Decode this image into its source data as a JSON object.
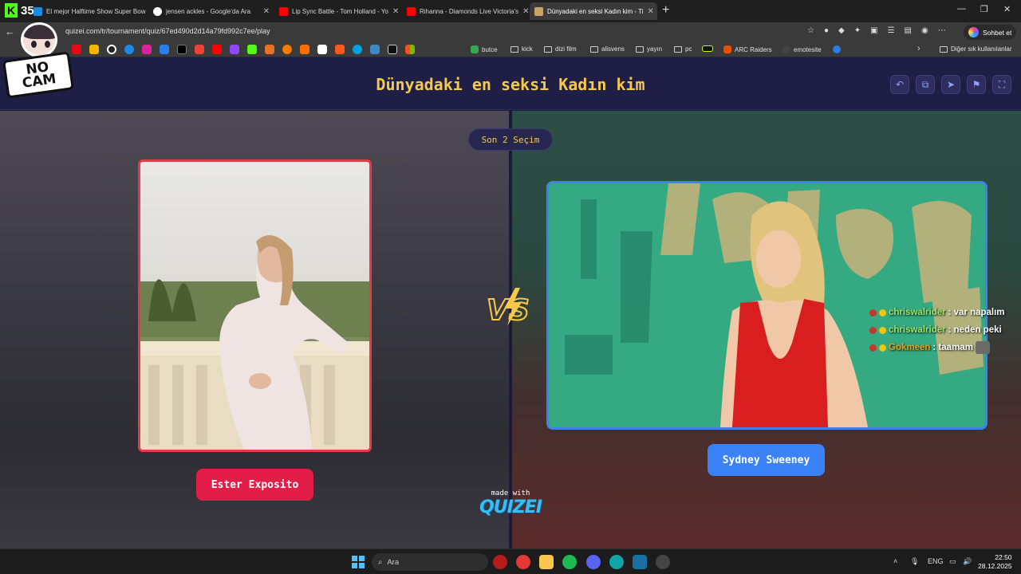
{
  "browser": {
    "tab_badge_count": "35",
    "tabs": [
      {
        "title": "El mejor Halftime Show Super Bow",
        "color": "#1e88e5"
      },
      {
        "title": "jensen ackles - Google'da Ara",
        "color": "#ffffff"
      },
      {
        "title": "Lip Sync Battle - Tom Holland - Yo",
        "color": "#ff0000"
      },
      {
        "title": "Rihanna - Diamonds Live Victoria's",
        "color": "#ff0000"
      },
      {
        "title": "Dünyadaki en seksi Kadın kim - Ti",
        "color": "#c9a46a"
      }
    ],
    "url": "quizei.com/tr/tournament/quiz/67ed490d2d14a79fd992c7ee/play",
    "copilot_label": "Sohbet et",
    "bookmarks": [
      {
        "label": "butce"
      },
      {
        "label": "kick"
      },
      {
        "label": "dizi film"
      },
      {
        "label": "alisvens"
      },
      {
        "label": "yayın"
      },
      {
        "label": "pc"
      },
      {
        "label": "ARC Raiders"
      },
      {
        "label": "emotesite"
      }
    ],
    "other_bookmarks": "Diğer sık kullanılanlar",
    "tab_close_glyph": "✕",
    "new_tab_glyph": "+",
    "minimize_glyph": "—",
    "maximize_glyph": "❐",
    "close_glyph": "✕",
    "back_glyph": "←"
  },
  "sticker": {
    "line1": "NO",
    "line2": "CAM"
  },
  "quiz": {
    "title": "Dünyadaki en seksi Kadın kim",
    "round_label": "Son 2 Seçim",
    "left": {
      "name": "Ester Exposito",
      "accent": "#e11d48"
    },
    "right": {
      "name": "Sydney Sweeney",
      "accent": "#3b82f6"
    },
    "made_with": "made with",
    "brand": "QUIZEI",
    "header_icons": [
      "undo-icon",
      "share-icon",
      "send-icon",
      "flag-icon",
      "fullscreen-icon"
    ]
  },
  "chat": [
    {
      "user": "chriswalrider",
      "message": ": var napalım"
    },
    {
      "user": "chriswalrider",
      "message": ": neden peki"
    },
    {
      "user": "Gokmeen",
      "message": ": taamam"
    }
  ],
  "taskbar": {
    "search_placeholder": "Ara",
    "language": "ENG",
    "time": "22:50",
    "date": "28.12.2025"
  }
}
